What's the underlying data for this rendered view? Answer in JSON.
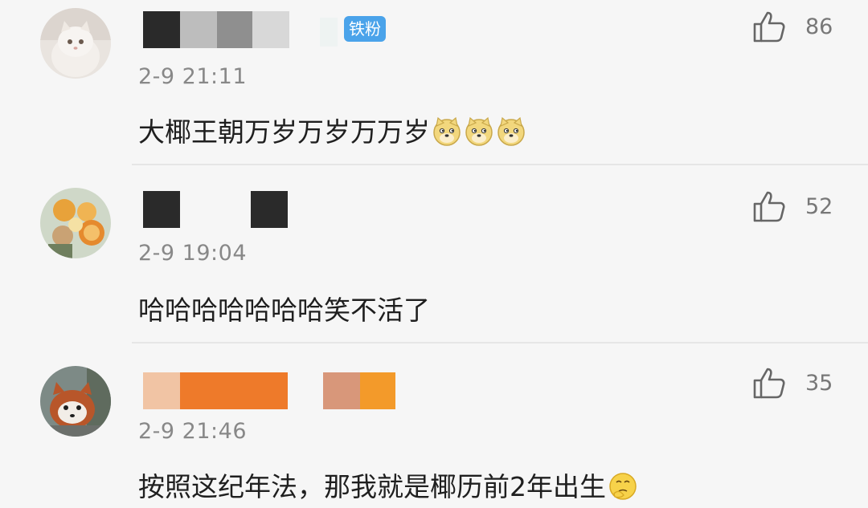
{
  "comments": [
    {
      "badge": "铁粉",
      "time": "2-9 21:11",
      "text": "大椰王朝万岁万岁万万岁",
      "emoji": [
        "doge-emoji",
        "doge-emoji",
        "doge-emoji"
      ],
      "likes": "86"
    },
    {
      "time": "2-9 19:04",
      "text": "哈哈哈哈哈哈哈笑不活了",
      "likes": "52"
    },
    {
      "time": "2-9 21:46",
      "text": "按照这纪年法，那我就是椰历前2年出生",
      "emoji": [
        "thinking-emoji"
      ],
      "likes": "35"
    }
  ],
  "colors": {
    "background": "#f6f6f6",
    "badge": "#4aa3ea",
    "timestamp": "#888888",
    "redact_orange": "#ee7a2a"
  }
}
